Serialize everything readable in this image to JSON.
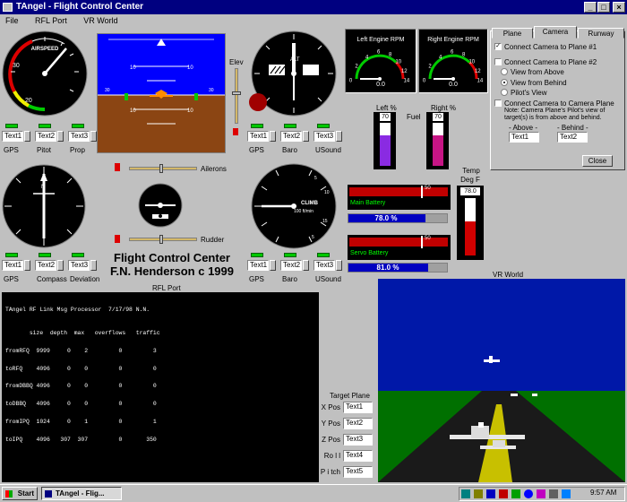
{
  "window": {
    "title": "TAngel - Flight Control Center",
    "minimize": "_",
    "maximize": "□",
    "close": "×"
  },
  "menu": [
    "File",
    "RFL Port",
    "VR World"
  ],
  "airspeed": {
    "label": "AIRSPEED",
    "ticks": [
      "30",
      "40",
      "20"
    ]
  },
  "attitude": {
    "pitch_labels": [
      "10",
      "10",
      "10",
      "10"
    ],
    "bank_marks": [
      "30",
      "30"
    ]
  },
  "altimeter": {
    "label": "ALT"
  },
  "elevator_label": "Elev",
  "ailerons_label": "Ailerons",
  "rudder_label": "Rudder",
  "climb": {
    "label": "CLIMB",
    "units": "100 ft/min",
    "ticks": [
      "5",
      "10",
      "15",
      "5",
      "10",
      "15"
    ]
  },
  "heading": {
    "label": "N"
  },
  "gauge_inputs": {
    "row1": [
      {
        "value": "Text1",
        "caption": "GPS"
      },
      {
        "value": "Text2",
        "caption": "Pitot"
      },
      {
        "value": "Text3",
        "caption": "Prop"
      }
    ],
    "row1_right": [
      {
        "value": "Text1",
        "caption": "GPS"
      },
      {
        "value": "Text2",
        "caption": "Baro"
      },
      {
        "value": "Text3",
        "caption": "USound"
      }
    ],
    "row2": [
      {
        "value": "Text1",
        "caption": "GPS"
      },
      {
        "value": "Text2",
        "caption": "Compass"
      },
      {
        "value": "Text3",
        "caption": "Deviation"
      }
    ],
    "row2_right": [
      {
        "value": "Text1",
        "caption": "GPS"
      },
      {
        "value": "Text2",
        "caption": "Baro"
      },
      {
        "value": "Text3",
        "caption": "USound"
      }
    ]
  },
  "fcc_title": {
    "line1": "Flight Control Center",
    "line2": "F.N. Henderson c 1999"
  },
  "left_engine": {
    "title": "Left Engine RPM",
    "value": "0.0",
    "ticks": [
      "4",
      "6",
      "8",
      "10",
      "2",
      "12",
      "0",
      "14"
    ]
  },
  "right_engine": {
    "title": "Right Engine RPM",
    "value": "0.0",
    "ticks": [
      "4",
      "6",
      "8",
      "10",
      "2",
      "12",
      "0",
      "14"
    ]
  },
  "fuel": {
    "label": "Fuel",
    "left_label": "Left %",
    "right_label": "Right %",
    "left_value": "70",
    "right_value": "70",
    "left_level": 0.7,
    "right_level": 0.7
  },
  "temp": {
    "label": "Temp",
    "units": "Deg F",
    "value": "78.0",
    "level": 0.6
  },
  "main_battery": {
    "label": "Main Battery",
    "needle_value": "50",
    "percent": "78.0 %",
    "percent_level": 0.78
  },
  "servo_battery": {
    "label": "Servo Battery",
    "needle_value": "50",
    "percent": "81.0 %",
    "percent_level": 0.81
  },
  "tabs": {
    "items": [
      "Plane",
      "Camera",
      "Runway"
    ],
    "active": "Camera"
  },
  "camera": {
    "opt1": "Connect Camera to Plane #1",
    "opt2": "Connect Camera to Plane #2",
    "view_above": "View from Above",
    "view_behind": "View from Behind",
    "pilots_view": "Pilot's View",
    "opt3": "Connect Camera to Camera Plane",
    "note": "Note: Camera Plane's Pilot's view of target(s) is from above and behind.",
    "above_label": "- Above -",
    "behind_label": "- Behind -",
    "above_value": "Text1",
    "behind_value": "Text2",
    "close": "Close"
  },
  "rfl_port": {
    "title": "RFL Port",
    "header": "TAngel RF Link Msg Processor  7/17/98 N.N.",
    "columns": "       size  depth  max   overflows   traffic",
    "rows": [
      "fromRFQ  9999     0    2         0         3",
      "toRFQ    4096     0    0         0         0",
      "fromDBBQ 4096     0    0         0         0",
      "toDBBQ   4096     0    0         0         0",
      "fromIPQ  1024     0    1         0         1",
      "toIPQ    4096   307  307         0       350"
    ]
  },
  "target_plane": {
    "title": "Target Plane",
    "fields": [
      {
        "label": "X Pos",
        "value": "Text1"
      },
      {
        "label": "Y Pos",
        "value": "Text2"
      },
      {
        "label": "Z Pos",
        "value": "Text3"
      },
      {
        "label": "Ro l l",
        "value": "Text4"
      },
      {
        "label": "P i tch",
        "value": "Text5"
      }
    ]
  },
  "vr_world": {
    "title": "VR World"
  },
  "taskbar": {
    "start": "Start",
    "task": "TAngel - Flig...",
    "clock": "9:57 AM"
  },
  "colors": {
    "sky": "#0000ff",
    "ground": "#8b4513",
    "title_bar": "#000080",
    "vr_sky": "#0018a8",
    "vr_grass": "#007000"
  }
}
